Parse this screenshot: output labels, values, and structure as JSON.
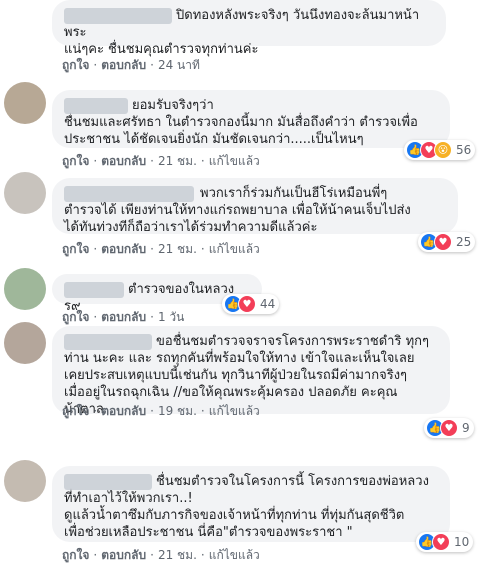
{
  "actions": {
    "like": "ถูกใจ",
    "reply": "ตอบกลับ",
    "edited": "แก้ไขแล้ว",
    "sep": "·"
  },
  "comments": [
    {
      "text": "ปิดทองหลังพระจริงๆ วันนึงทองจะล้นมาหน้าพระ\nแน่ๆคะ ชื่นชมคุณตำรวจทุกท่านค่ะ",
      "time": "24 นาที",
      "edited": false,
      "reactions": null
    },
    {
      "text": "ยอมรับจริงๆว่า\nชื่นชมและศรัทธา ในตำรวจกองนี้มาก มันสื่อถึงคำว่า ตำรวจเพื่อ\nประชาชน ได้ชัดเจนยิ่งนัก มันชัดเจนกว่า.....เป็นไหนๆ",
      "time": "21 ชม.",
      "edited": true,
      "reactions": {
        "count": "56",
        "icons": [
          "like-icon",
          "love-icon",
          "wow-icon"
        ]
      }
    },
    {
      "text": "พวกเราก็ร่วมกันเป็นฮีโร่เหมือนพี่ๆ\nตำรวจได้ เพียงท่านให้ทางแก่รถพยาบาล เพื่อให้น้าคนเจ็บไปส่ง\nได้ทันท่วงทีก็ถือว่าเราได้ร่วมทำความดีแล้วค่ะ",
      "time": "21 ชม.",
      "edited": true,
      "reactions": {
        "count": "25",
        "icons": [
          "like-icon",
          "love-icon"
        ]
      }
    },
    {
      "text": "ตำรวจของในหลวง ร๙",
      "time": "1 วัน",
      "edited": false,
      "reactions": {
        "count": "44",
        "icons": [
          "like-icon",
          "love-icon"
        ]
      }
    },
    {
      "text": "ขอชื่นชมตำรวจจราจรโครงการพระราชดำริ ทุกๆ\nท่าน นะคะ และ รถทุกคันที่พร้อมใจให้ทาง เข้าใจและเห็นใจเลย\nเคยประสบเหตุแบบนี้เช่นกัน ทุกวินาทีผู้ป่วยในรถมีค่ามากจริงๆ\nเมื่ออยู่ในรถฉุกเฉิน //ขอให้คุณพระคุ้มครอง ปลอดภัย คะคุณ\nน้าตาล",
      "time": "19 ชม.",
      "edited": true,
      "reactions": {
        "count": "9",
        "icons": [
          "like-icon",
          "love-icon"
        ]
      }
    },
    {
      "text": "ชื่นชมตำรวจในโครงการนี้ โครงการของพ่อหลวง\nที่ทำเอาไว้ให้พวกเรา..!\nดูแล้วน้ำตาซึมกับภารกิจของเจ้าหน้าที่ทุกท่าน ที่ทุ่มกันสุดชีวิต\nเพื่อช่วยเหลือประชาชน นี่คือ\"ตำรวจของพระราชา \"",
      "time": "21 ชม.",
      "edited": true,
      "reactions": {
        "count": "10",
        "icons": [
          "like-icon",
          "love-icon"
        ]
      }
    }
  ]
}
